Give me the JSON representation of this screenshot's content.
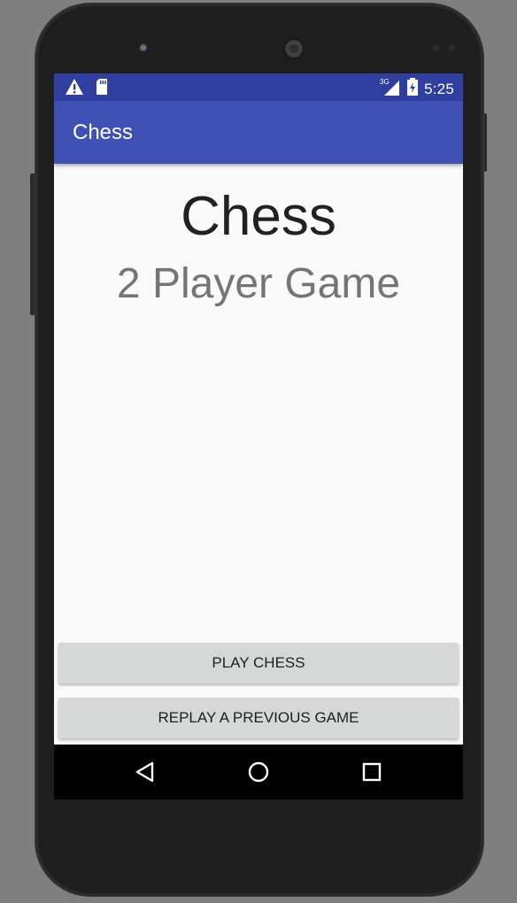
{
  "status_bar": {
    "time": "5:25",
    "network_label": "3G",
    "icons": [
      "warning-icon",
      "sd-card-icon",
      "cellular-signal-icon",
      "battery-icon"
    ]
  },
  "app_bar": {
    "title": "Chess"
  },
  "content": {
    "title": "Chess",
    "subtitle": "2 Player Game"
  },
  "buttons": {
    "play": "PLAY CHESS",
    "replay": "REPLAY A PREVIOUS GAME"
  },
  "nav_bar": {
    "icons": [
      "back-icon",
      "home-icon",
      "recents-icon"
    ]
  },
  "colors": {
    "status_bar": "#303f9f",
    "app_bar": "#3f51b5",
    "background": "#fafafa",
    "button": "#d6d7d7"
  }
}
